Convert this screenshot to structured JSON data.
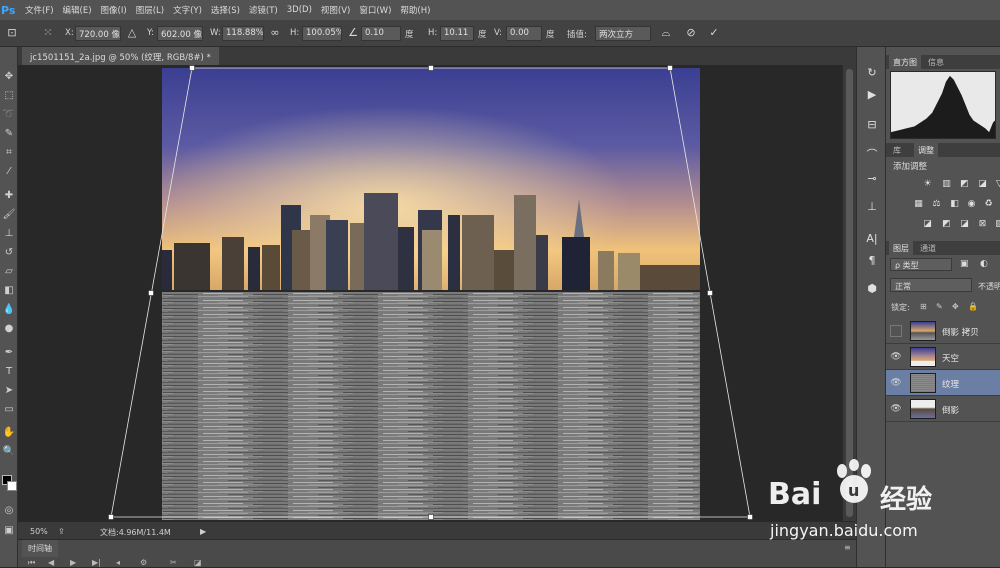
{
  "app": {
    "logo": "Ps"
  },
  "menu": [
    {
      "label": "文件(F)"
    },
    {
      "label": "编辑(E)"
    },
    {
      "label": "图像(I)"
    },
    {
      "label": "图层(L)"
    },
    {
      "label": "文字(Y)"
    },
    {
      "label": "选择(S)"
    },
    {
      "label": "滤镜(T)"
    },
    {
      "label": "3D(D)"
    },
    {
      "label": "视图(V)"
    },
    {
      "label": "窗口(W)"
    },
    {
      "label": "帮助(H)"
    }
  ],
  "options": {
    "x_label": "X:",
    "x_value": "720.00 像素",
    "y_label": "Y:",
    "y_value": "602.00 像素",
    "w_label": "W:",
    "w_value": "118.88%",
    "h_label": "H:",
    "h_value": "100.05%",
    "angle_value": "0.10",
    "angle_unit": "度",
    "hskew_label": "H:",
    "hskew_value": "10.11",
    "hskew_unit": "度",
    "vskew_label": "V:",
    "vskew_value": "0.00",
    "vskew_unit": "度",
    "interp_label": "插值:",
    "interp_value": "两次立方"
  },
  "document": {
    "tab_title": "jc1501151_2a.jpg @ 50% (纹理, RGB/8#) *",
    "zoom": "50%",
    "doc_info": "文档:4.96M/11.4M"
  },
  "timeline": {
    "title": "时间轴"
  },
  "panels": {
    "histogram_tab": "直方图",
    "info_tab": "信息",
    "library_tab": "库",
    "adjust_tab": "调整",
    "adjust_title": "添加调整",
    "layers_tab": "图层",
    "channels_tab": "通道",
    "filter_kind": "类型",
    "blend_mode": "正常",
    "opacity_label": "不透明",
    "lock_label": "锁定:"
  },
  "layers": [
    {
      "name": "倒影 拷贝",
      "visible": false,
      "selected": false
    },
    {
      "name": "天空",
      "visible": true,
      "selected": false
    },
    {
      "name": "纹理",
      "visible": true,
      "selected": true
    },
    {
      "name": "倒影",
      "visible": true,
      "selected": false
    }
  ],
  "watermark": {
    "brand": "Bai",
    "brand2": "经验",
    "url": "jingyan.baidu.com"
  }
}
